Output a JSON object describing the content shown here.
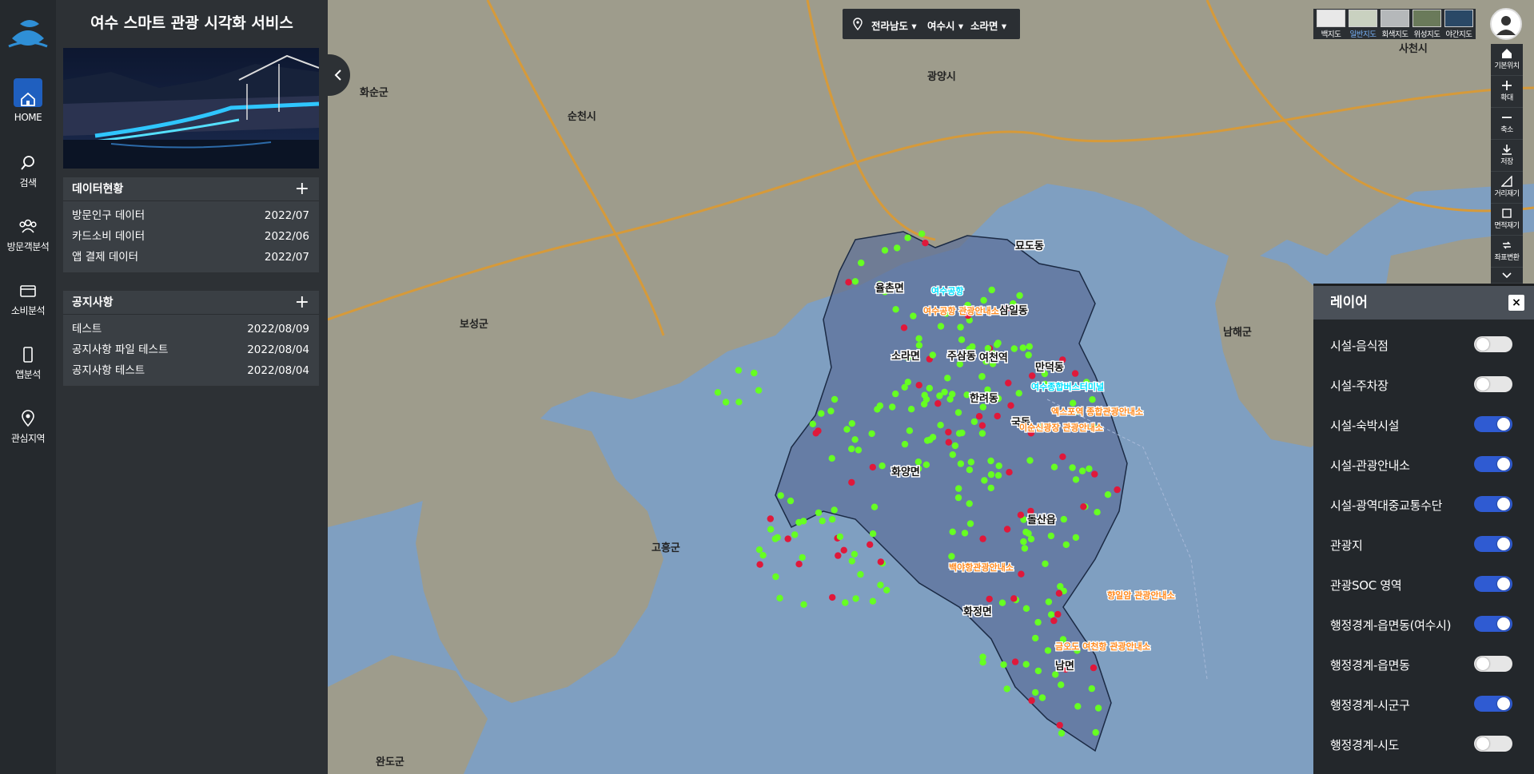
{
  "nav": [
    {
      "label": "HOME",
      "icon": "home-icon",
      "active": true
    },
    {
      "label": "검색",
      "icon": "search-icon",
      "active": false
    },
    {
      "label": "방문객분석",
      "icon": "users-icon",
      "active": false
    },
    {
      "label": "소비분석",
      "icon": "card-icon",
      "active": false
    },
    {
      "label": "앱분석",
      "icon": "phone-icon",
      "active": false
    },
    {
      "label": "관심지역",
      "icon": "pin-icon",
      "active": false
    }
  ],
  "panel": {
    "title": "여수 스마트 관광 시각화 서비스",
    "data_status": {
      "title": "데이터현황",
      "plus": "+",
      "rows": [
        {
          "name": "방문인구 데이터",
          "date": "2022/07"
        },
        {
          "name": "카드소비 데이터",
          "date": "2022/06"
        },
        {
          "name": "앱 결제 데이터",
          "date": "2022/07"
        }
      ]
    },
    "notices": {
      "title": "공지사항",
      "plus": "+",
      "rows": [
        {
          "name": "테스트",
          "date": "2022/08/09"
        },
        {
          "name": "공지사항 파일 테스트",
          "date": "2022/08/04"
        },
        {
          "name": "공지사항 테스트",
          "date": "2022/08/04"
        }
      ]
    }
  },
  "region": {
    "province": "전라남도",
    "city": "여수시",
    "district": "소라면"
  },
  "basemaps": [
    {
      "label": "백지도",
      "selected": false,
      "color": "#e8e8e8"
    },
    {
      "label": "일반지도",
      "selected": true,
      "color": "#c9d1c0"
    },
    {
      "label": "회색지도",
      "selected": false,
      "color": "#b5b8ba"
    },
    {
      "label": "위성지도",
      "selected": false,
      "color": "#6a7a5a"
    },
    {
      "label": "야간지도",
      "selected": false,
      "color": "#2a4866"
    }
  ],
  "tools": [
    {
      "label": "기본위치",
      "icon": "home-icon"
    },
    {
      "label": "확대",
      "icon": "zoom-in-icon"
    },
    {
      "label": "축소",
      "icon": "zoom-out-icon"
    },
    {
      "label": "저장",
      "icon": "download-icon"
    },
    {
      "label": "거리재기",
      "icon": "ruler-icon"
    },
    {
      "label": "면적재기",
      "icon": "area-icon"
    },
    {
      "label": "좌표변환",
      "icon": "transform-icon"
    }
  ],
  "layers": {
    "title": "레이어",
    "close": "×",
    "items": [
      {
        "label": "시설-음식점",
        "on": false
      },
      {
        "label": "시설-주차장",
        "on": false
      },
      {
        "label": "시설-숙박시설",
        "on": true
      },
      {
        "label": "시설-관광안내소",
        "on": true
      },
      {
        "label": "시설-광역대중교통수단",
        "on": true
      },
      {
        "label": "관광지",
        "on": true
      },
      {
        "label": "관광SOC 영역",
        "on": true
      },
      {
        "label": "행정경계-읍면동(여수시)",
        "on": true
      },
      {
        "label": "행정경계-읍면동",
        "on": false
      },
      {
        "label": "행정경계-시군구",
        "on": true
      },
      {
        "label": "행정경계-시도",
        "on": false
      }
    ]
  },
  "map_labels": {
    "regions": [
      "화순군",
      "순천시",
      "광양시",
      "사천시",
      "보성군",
      "남해군",
      "고흥군",
      "완도군"
    ],
    "districts": [
      "율촌면",
      "묘도동",
      "삼일동",
      "소라면",
      "주삼동",
      "화양면",
      "돌산읍",
      "화정면",
      "남면",
      "여천역",
      "만덕동",
      "국동",
      "한려동"
    ],
    "poi": [
      "여수공항",
      "여수공항 관광안내소",
      "여수종합버스터미널",
      "엑스포역 종합관광안내소",
      "이순신광장 관광안내소",
      "백야항관광안내소",
      "향일암 관광안내소",
      "금오도 여천항 관광안내소"
    ]
  },
  "colors": {
    "accent": "#1f5fbf",
    "water": "#7fa0c2",
    "land": "#9c9a8a",
    "admin_fill": "#5b6f99",
    "green_marker": "#66ff22",
    "red_marker": "#e0183a",
    "poi_orange": "#ff8a1f"
  }
}
